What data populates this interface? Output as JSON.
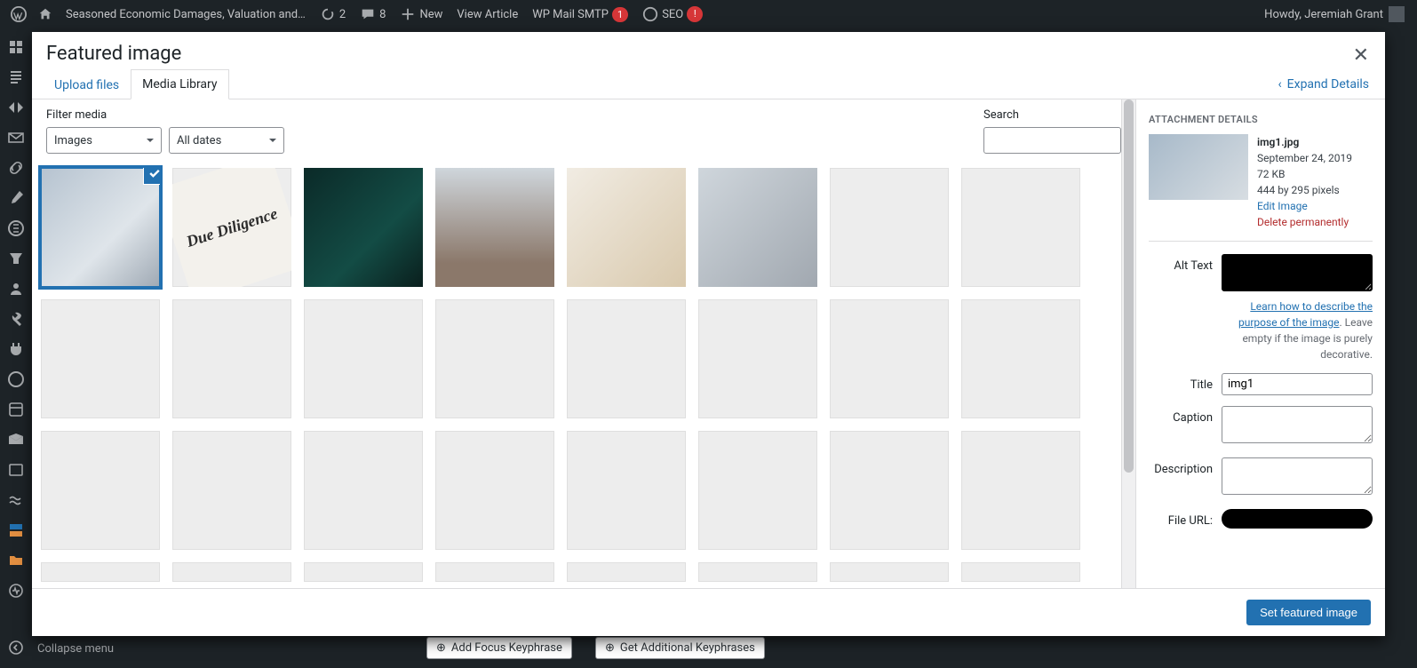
{
  "admin_bar": {
    "site_name": "Seasoned Economic Damages, Valuation and…",
    "updates_count": "2",
    "comments_count": "8",
    "new_label": "New",
    "view_article": "View Article",
    "wp_mail_smtp": "WP Mail SMTP",
    "wp_mail_smtp_badge": "1",
    "seo_label": "SEO",
    "seo_badge": "!",
    "howdy": "Howdy, Jeremiah Grant"
  },
  "sidebar": {
    "collapse_label": "Collapse menu"
  },
  "modal": {
    "title": "Featured image",
    "tabs": {
      "upload": "Upload files",
      "library": "Media Library"
    },
    "expand_details": "Expand Details",
    "filter_label": "Filter media",
    "filter_type_selected": "Images",
    "filter_date_selected": "All dates",
    "search_label": "Search",
    "set_button": "Set featured image"
  },
  "details": {
    "heading": "ATTACHMENT DETAILS",
    "filename": "img1.jpg",
    "date": "September 24, 2019",
    "filesize": "72 KB",
    "dimensions": "444 by 295 pixels",
    "edit_link": "Edit Image",
    "delete_link": "Delete permanently",
    "alt_label": "Alt Text",
    "alt_help_link": "Learn how to describe the purpose of the image",
    "alt_help_rest": ". Leave empty if the image is purely decorative.",
    "title_label": "Title",
    "title_value": "img1",
    "caption_label": "Caption",
    "description_label": "Description",
    "fileurl_label": "File URL:"
  },
  "bg": {
    "add_focus": "Add Focus Keyphrase",
    "get_additional": "Get Additional Keyphrases"
  }
}
